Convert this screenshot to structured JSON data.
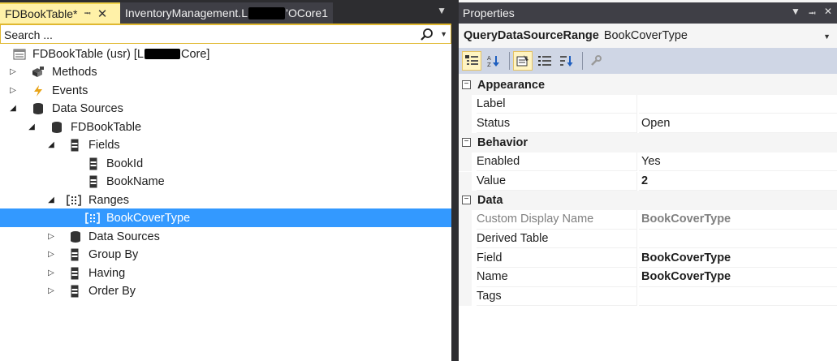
{
  "tabs": {
    "active": {
      "label": "FDBookTable*",
      "pin": "⌥",
      "close": "✕"
    },
    "inactive": {
      "label_start": "InventoryManagement.L",
      "label_end": "’OCore1"
    }
  },
  "search": {
    "placeholder": "Search ..."
  },
  "tree": [
    {
      "label_start": "FDBookTable (usr) [L",
      "label_end": "Core]",
      "icon": "model-icon"
    },
    {
      "label": "Methods",
      "icon": "methods-icon"
    },
    {
      "label": "Events",
      "icon": "events-icon"
    },
    {
      "label": "Data Sources",
      "icon": "data-sources-icon"
    },
    {
      "label": "FDBookTable",
      "icon": "datasource-icon"
    },
    {
      "label": "Fields",
      "icon": "fields-icon"
    },
    {
      "label": "BookId",
      "icon": "field-icon"
    },
    {
      "label": "BookName",
      "icon": "field-icon"
    },
    {
      "label": "Ranges",
      "icon": "ranges-icon"
    },
    {
      "label": "BookCoverType",
      "icon": "range-icon"
    },
    {
      "label": "Data Sources",
      "icon": "data-sources-icon"
    },
    {
      "label": "Group By",
      "icon": "group-by-icon"
    },
    {
      "label": "Having",
      "icon": "having-icon"
    },
    {
      "label": "Order By",
      "icon": "order-by-icon"
    }
  ],
  "properties": {
    "title": "Properties",
    "object_type": "QueryDataSourceRange",
    "object_name": "BookCoverType",
    "categories": {
      "appearance": "Appearance",
      "behavior": "Behavior",
      "data": "Data"
    },
    "rows": {
      "label": {
        "name": "Label",
        "value": ""
      },
      "status": {
        "name": "Status",
        "value": "Open"
      },
      "enabled": {
        "name": "Enabled",
        "value": "Yes"
      },
      "value": {
        "name": "Value",
        "value": "2"
      },
      "custom_display_name": {
        "name": "Custom Display Name",
        "value": "BookCoverType"
      },
      "derived_table": {
        "name": "Derived Table",
        "value": ""
      },
      "field": {
        "name": "Field",
        "value": "BookCoverType"
      },
      "name": {
        "name": "Name",
        "value": "BookCoverType"
      },
      "tags": {
        "name": "Tags",
        "value": ""
      }
    }
  },
  "colors": {
    "selection": "#3399ff",
    "active_tab": "#fff1a8",
    "dark_chrome": "#2d2d30",
    "toolbar": "#cfd6e5"
  }
}
